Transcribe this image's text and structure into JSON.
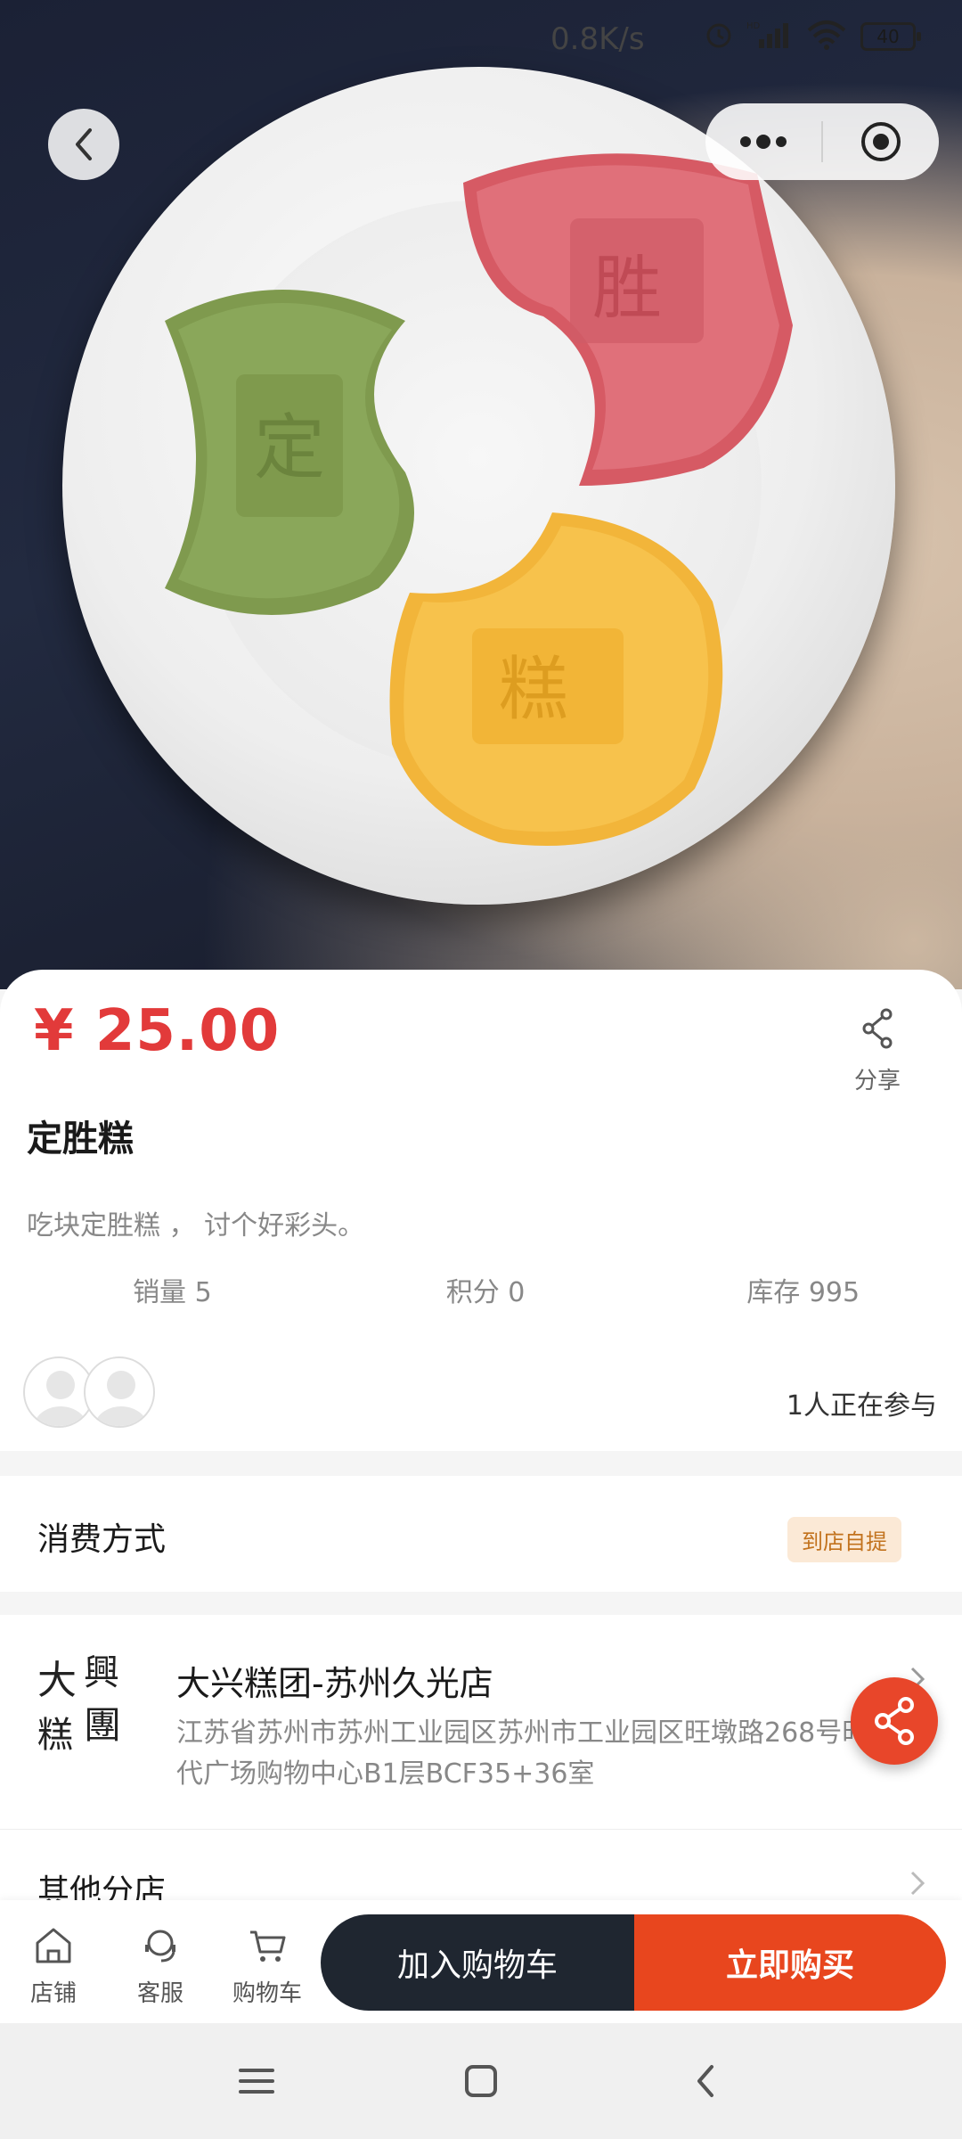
{
  "status_bar": {
    "speed": "0.8K/s",
    "battery": "40",
    "network": "HD"
  },
  "product": {
    "price": "¥ 25.00",
    "title": "定胜糕",
    "description": "吃块定胜糕 ， 讨个好彩头。",
    "sales": "销量 5",
    "points": "积分 0",
    "stock": "库存 995",
    "share_label": "分享",
    "participants": "1人正在参与",
    "image_alt": "three pastel dingsheng cakes on a white plate"
  },
  "consumption": {
    "label": "消费方式",
    "tag": "到店自提"
  },
  "store": {
    "name": "大兴糕团-苏州久光店",
    "address": "江苏省苏州市苏州工业园区苏州市工业园区旺墩路268号时代广场购物中心B1层BCF35+36室",
    "logo_chars": [
      "大",
      "興",
      "糕",
      "團"
    ],
    "others_label": "其他分店"
  },
  "bottom_bar": {
    "tabs": [
      {
        "label": "店铺",
        "icon": "store-icon"
      },
      {
        "label": "客服",
        "icon": "service-icon"
      },
      {
        "label": "购物车",
        "icon": "cart-icon"
      }
    ],
    "add_to_cart": "加入购物车",
    "buy_now": "立即购买"
  },
  "colors": {
    "price": "#e23a3a",
    "buy": "#e8461e",
    "cart_btn": "#1f2630",
    "tag_bg": "#fbe9d6",
    "tag_text": "#c2721d"
  }
}
